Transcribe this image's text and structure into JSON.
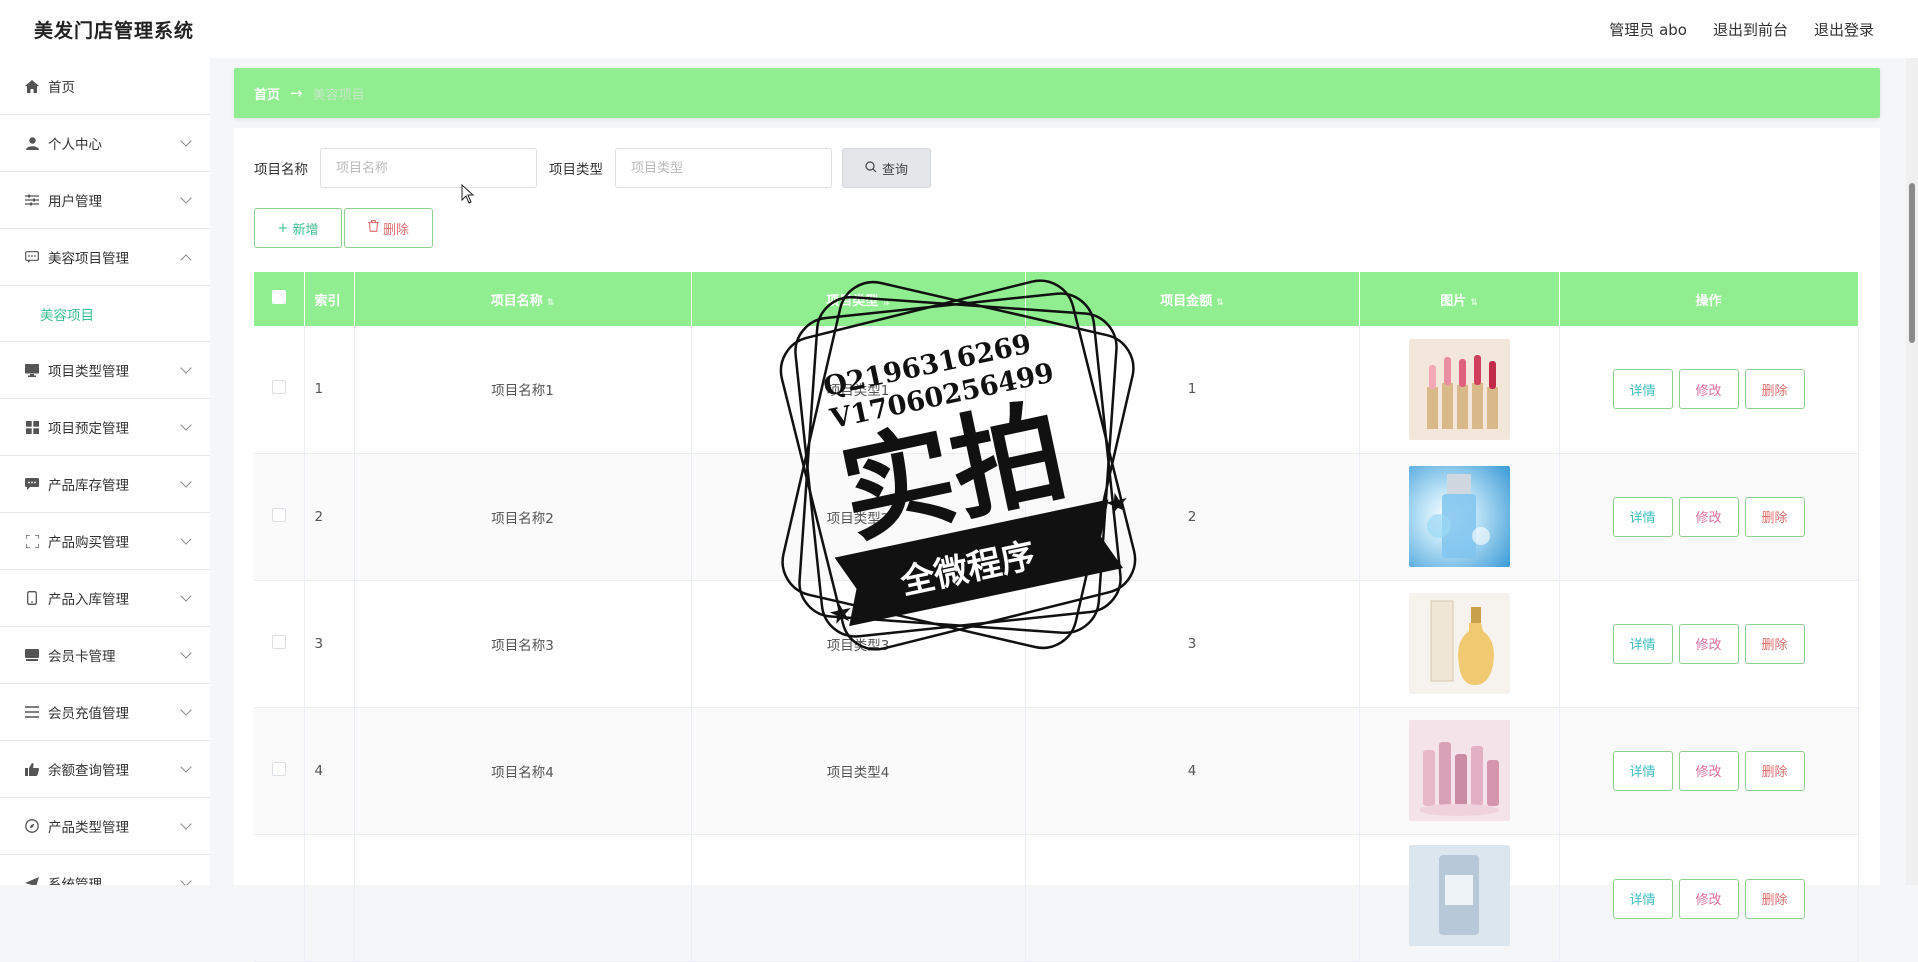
{
  "header": {
    "title": "美发门店管理系统",
    "admin_label": "管理员 abo",
    "back_to_front": "退出到前台",
    "logout": "退出登录"
  },
  "sidebar": {
    "items": [
      {
        "label": "首页",
        "icon": "home-icon"
      },
      {
        "label": "个人中心",
        "icon": "user-icon"
      },
      {
        "label": "用户管理",
        "icon": "sliders-icon"
      },
      {
        "label": "美容项目管理",
        "icon": "chat-icon",
        "expanded": true
      },
      {
        "label": "项目类型管理",
        "icon": "monitor-icon"
      },
      {
        "label": "项目预定管理",
        "icon": "grid-icon"
      },
      {
        "label": "产品库存管理",
        "icon": "message-icon"
      },
      {
        "label": "产品购买管理",
        "icon": "scan-icon"
      },
      {
        "label": "产品入库管理",
        "icon": "phone-icon"
      },
      {
        "label": "会员卡管理",
        "icon": "card-icon"
      },
      {
        "label": "会员充值管理",
        "icon": "list-icon"
      },
      {
        "label": "余额查询管理",
        "icon": "thumb-icon"
      },
      {
        "label": "产品类型管理",
        "icon": "compass-icon"
      },
      {
        "label": "系统管理",
        "icon": "send-icon"
      }
    ],
    "submenu_active": "美容项目"
  },
  "breadcrumb": {
    "home": "首页",
    "current": "美容项目"
  },
  "search": {
    "name_label": "项目名称",
    "name_placeholder": "项目名称",
    "type_label": "项目类型",
    "type_placeholder": "项目类型",
    "query_button": "查询"
  },
  "actions": {
    "add": "新增",
    "delete": "删除"
  },
  "table": {
    "headers": [
      "索引",
      "项目名称",
      "项目类型",
      "项目金额",
      "图片",
      "操作"
    ],
    "rows": [
      {
        "index": "1",
        "name": "项目名称1",
        "type": "项目类型1",
        "amount": "1",
        "image": "lipstick-image"
      },
      {
        "index": "2",
        "name": "项目名称2",
        "type": "项目类型2",
        "amount": "2",
        "image": "serum-bottle-image"
      },
      {
        "index": "3",
        "name": "项目名称3",
        "type": "项目类型3",
        "amount": "3",
        "image": "perfume-image"
      },
      {
        "index": "4",
        "name": "项目名称4",
        "type": "项目类型4",
        "amount": "4",
        "image": "cosmetics-set-image"
      },
      {
        "index": "",
        "name": "",
        "type": "",
        "amount": "",
        "image": "essence-bottle-image"
      }
    ],
    "op_detail": "详情",
    "op_edit": "修改",
    "op_delete": "删除"
  },
  "watermark": {
    "line1": "Q2196316269",
    "line2": "V17060256499",
    "big": "实拍",
    "ribbon": "全微程序"
  },
  "colors": {
    "accent_green": "#90ee90",
    "text_teal": "#3fbf8f"
  }
}
